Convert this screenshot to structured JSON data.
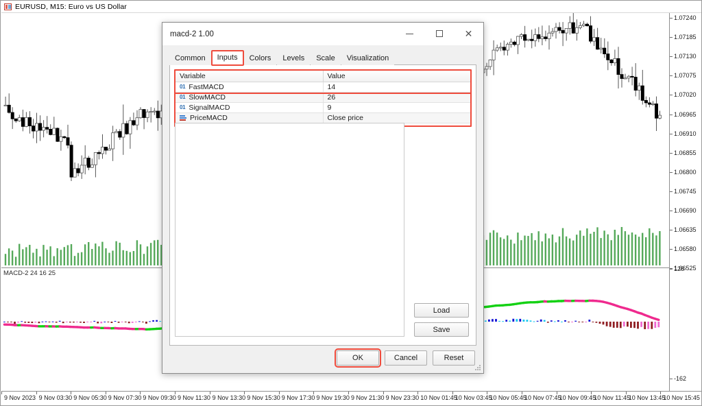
{
  "chart": {
    "symbol_icon": "symbol-icon",
    "title": "EURUSD, M15:  Euro vs US Dollar",
    "indicator_label": "MACD-2 24 16 25",
    "price_axis": [
      "1.07240",
      "1.07185",
      "1.07130",
      "1.07075",
      "1.07020",
      "1.06965",
      "1.06910",
      "1.06855",
      "1.06800",
      "1.06745",
      "1.06690",
      "1.06635",
      "1.06580",
      "1.06525"
    ],
    "indicator_axis": [
      "126",
      "-162"
    ],
    "time_axis": [
      "9 Nov 2023",
      "9 Nov 03:30",
      "9 Nov 05:30",
      "9 Nov 07:30",
      "9 Nov 09:30",
      "9 Nov 11:30",
      "9 Nov 13:30",
      "9 Nov 15:30",
      "9 Nov 17:30",
      "9 Nov 19:30",
      "9 Nov 21:30",
      "9 Nov 23:30",
      "10 Nov 01:45",
      "10 Nov 03:45",
      "10 Nov 05:45",
      "10 Nov 07:45",
      "10 Nov 09:45",
      "10 Nov 11:45",
      "10 Nov 13:45",
      "10 Nov 15:45"
    ],
    "colors": {
      "candle_up": "#ffffff",
      "candle_down": "#000000",
      "candle_outline": "#555555",
      "volume": "#55a95a",
      "macd_line_down": "#ef2a8e",
      "macd_line_up": "#14d114",
      "hist_dark_red": "#8f1d22",
      "hist_violet": "#ef6ad0",
      "hist_blue": "#1414d6",
      "hist_cyan": "#14c8ef",
      "axis": "#8f8f8f"
    }
  },
  "dialog": {
    "title": "macd-2 1.00",
    "window_buttons": {
      "minimize": "minimize-icon",
      "maximize": "maximize-icon",
      "close": "close-icon"
    },
    "tabs": [
      {
        "label": "Common",
        "active": false
      },
      {
        "label": "Inputs",
        "active": true
      },
      {
        "label": "Colors",
        "active": false
      },
      {
        "label": "Levels",
        "active": false
      },
      {
        "label": "Scale",
        "active": false
      },
      {
        "label": "Visualization",
        "active": false
      }
    ],
    "inputs_table": {
      "columns": [
        "Variable",
        "Value"
      ],
      "rows": [
        {
          "icon": "int-type-icon",
          "variable": "FastMACD",
          "value": "14"
        },
        {
          "icon": "int-type-icon",
          "variable": "SlowMACD",
          "value": "26"
        },
        {
          "icon": "int-type-icon",
          "variable": "SignalMACD",
          "value": "9"
        },
        {
          "icon": "price-type-icon",
          "variable": "PriceMACD",
          "value": "Close price"
        }
      ]
    },
    "side_buttons": [
      {
        "label": "Load"
      },
      {
        "label": "Save"
      }
    ],
    "footer_buttons": [
      {
        "label": "OK",
        "highlighted": true
      },
      {
        "label": "Cancel",
        "highlighted": false
      },
      {
        "label": "Reset",
        "highlighted": false
      }
    ],
    "highlight_color": "#ef4b3c"
  }
}
